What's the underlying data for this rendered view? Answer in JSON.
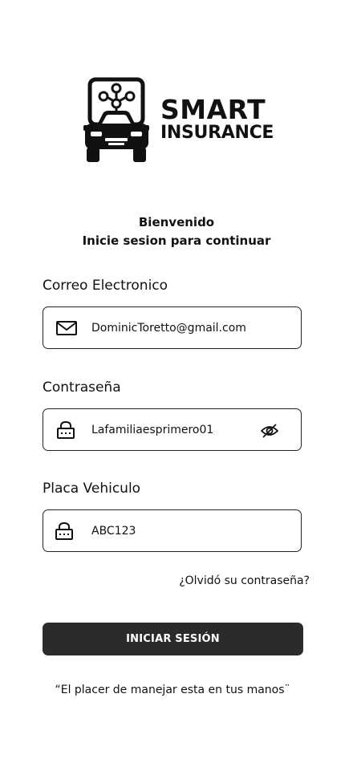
{
  "brand": {
    "line1": "SMART",
    "line2": "INSURANCE",
    "logo_icon": "connected-car-icon"
  },
  "welcome": {
    "title": "Bienvenido",
    "subtitle": "Inicie sesion para continuar"
  },
  "email": {
    "label": "Correo Electronico",
    "value": "DominicToretto@gmail.com",
    "icon": "mail-icon"
  },
  "password": {
    "label": "Contraseña",
    "value": "Lafamiliaesprimero01",
    "icon": "lock-icon",
    "toggle_icon": "eye-off-icon"
  },
  "plate": {
    "label": "Placa Vehiculo",
    "value": "ABC123",
    "icon": "lock-icon"
  },
  "forgot_password": "¿Olvidó su contraseña?",
  "login_button": "INICIAR SESIÓN",
  "tagline": "“El placer de manejar esta en tus manos¨",
  "colors": {
    "primary_button": "#2b2b2b",
    "text": "#111111",
    "background": "#ffffff"
  }
}
